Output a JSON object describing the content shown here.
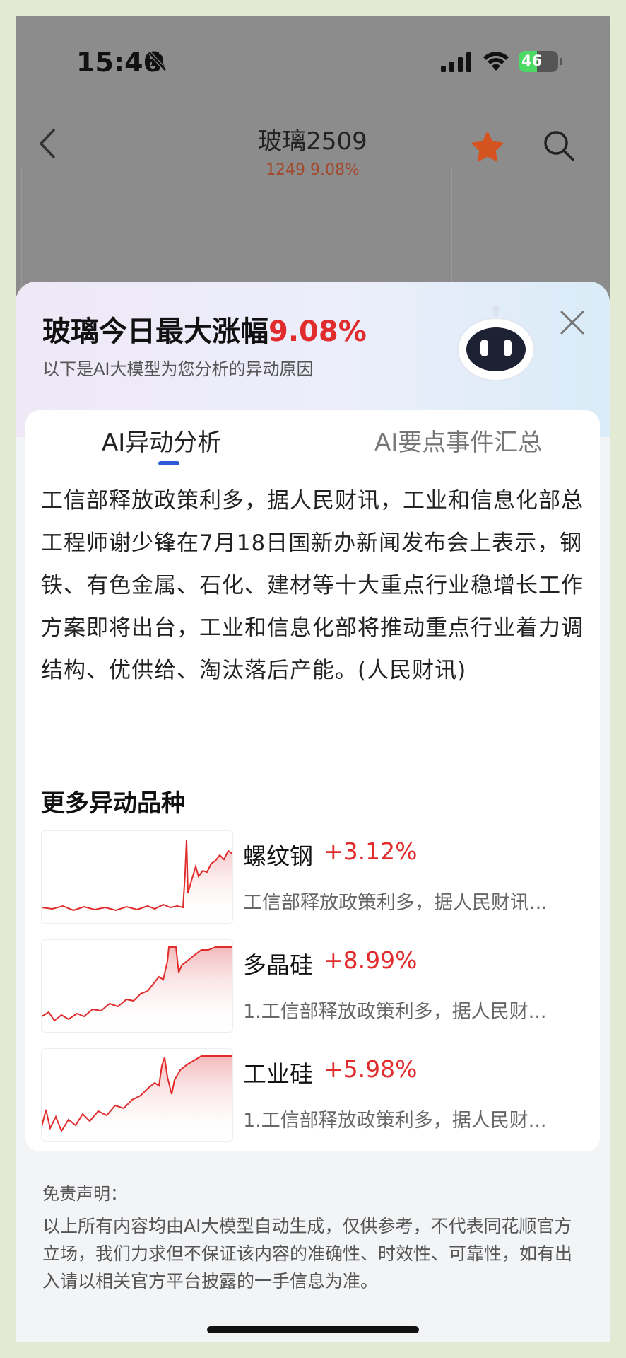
{
  "status_bar": {
    "time": "15:46",
    "battery": "46",
    "battery_level": 0.46
  },
  "nav": {
    "title": "玻璃2509",
    "subtitle": "1249 9.08%"
  },
  "sheet": {
    "headline_prefix": "玻璃今日最大涨幅",
    "headline_pct": "9.08%",
    "subline": "以下是AI大模型为您分析的异动原因",
    "tabs": [
      {
        "label": "AI异动分析",
        "active": true
      },
      {
        "label": "AI要点事件汇总",
        "active": false
      }
    ],
    "analysis": "工信部释放政策利多，据人民财讯，工业和信息化部总工程师谢少锋在7月18日国新办新闻发布会上表示，钢铁、有色金属、石化、建材等十大重点行业稳增长工作方案即将出台，工业和信息化部将推动重点行业着力调结构、优供给、淘汰落后产能。(人民财讯)",
    "more_title": "更多异动品种",
    "items": [
      {
        "name": "螺纹钢",
        "change": "+3.12%",
        "desc": "工信部释放政策利多，据人民财讯..."
      },
      {
        "name": "多晶硅",
        "change": "+8.99%",
        "desc": "1.工信部释放政策利多，据人民财..."
      },
      {
        "name": "工业硅",
        "change": "+5.98%",
        "desc": "1.工信部释放政策利多，据人民财..."
      }
    ],
    "disclaimer_title": "免责声明：",
    "disclaimer": "以上所有内容均由AI大模型自动生成，仅供参考，不代表同花顺官方立场，我们力求但不保证该内容的准确性、时效性、可靠性，如有出入请以相关官方平台披露的一手信息为准。"
  },
  "colors": {
    "up": "#e02c2c",
    "accent": "#2b5cd6",
    "star": "#d4531f"
  }
}
